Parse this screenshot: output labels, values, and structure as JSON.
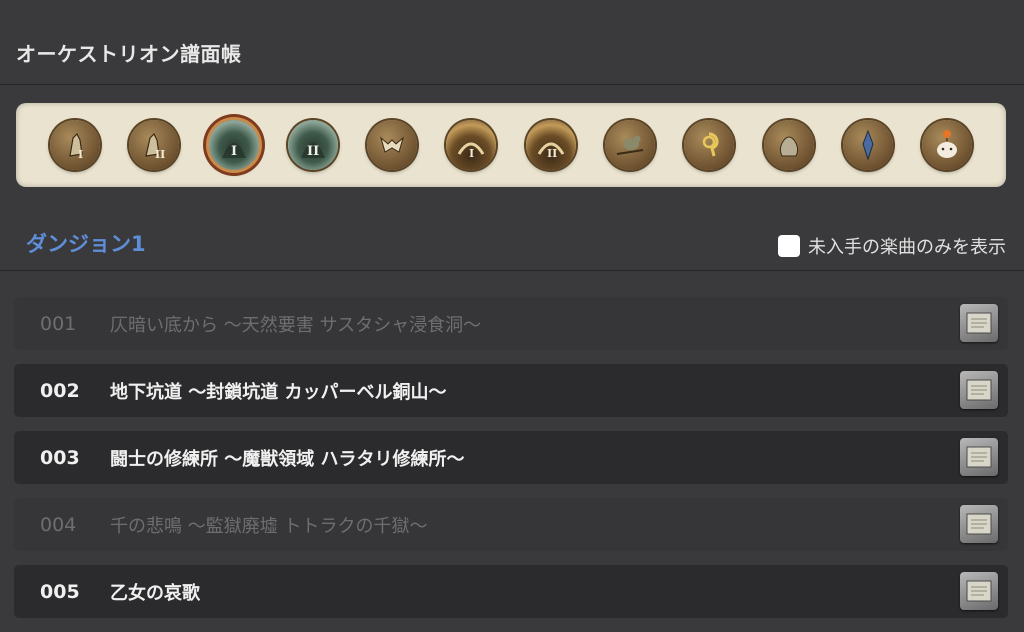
{
  "header": {
    "title": "オーケストリオン譜面帳"
  },
  "categories": [
    {
      "icon": "crystal-tower-i-icon",
      "selected": false
    },
    {
      "icon": "crystal-tower-ii-icon",
      "selected": false
    },
    {
      "icon": "dungeon-i-icon",
      "selected": true
    },
    {
      "icon": "dungeon-ii-icon",
      "selected": false
    },
    {
      "icon": "trial-icon",
      "selected": false
    },
    {
      "icon": "raid-i-icon",
      "selected": false
    },
    {
      "icon": "raid-ii-icon",
      "selected": false
    },
    {
      "icon": "bird-icon",
      "selected": false
    },
    {
      "icon": "ring-icon",
      "selected": false
    },
    {
      "icon": "bag-icon",
      "selected": false
    },
    {
      "icon": "crystal-icon",
      "selected": false
    },
    {
      "icon": "moogle-icon",
      "selected": false
    }
  ],
  "section": {
    "title": "ダンジョン1"
  },
  "filter": {
    "label": "未入手の楽曲のみを表示",
    "checked": false
  },
  "tracks": [
    {
      "number": "001",
      "name": "仄暗い底から 〜天然要害 サスタシャ浸食洞〜",
      "owned": false
    },
    {
      "number": "002",
      "name": "地下坑道 〜封鎖坑道 カッパーベル銅山〜",
      "owned": true
    },
    {
      "number": "003",
      "name": "闘士の修練所 〜魔獣領域 ハラタリ修練所〜",
      "owned": true
    },
    {
      "number": "004",
      "name": "千の悲鳴 〜監獄廃墟 トトラクの千獄〜",
      "owned": false
    },
    {
      "number": "005",
      "name": "乙女の哀歌",
      "owned": true
    }
  ],
  "colors": {
    "accent": "#5f8ed8",
    "selected_ring": "#c98a4a"
  }
}
